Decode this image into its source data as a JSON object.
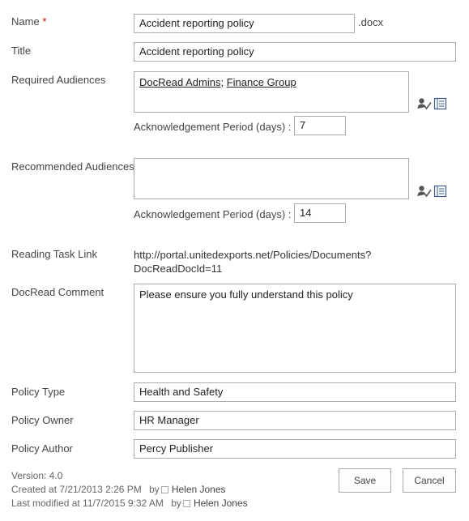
{
  "fields": {
    "name": {
      "label": "Name",
      "required_mark": "*",
      "value": "Accident reporting policy",
      "extension": ".docx"
    },
    "title": {
      "label": "Title",
      "value": "Accident reporting policy"
    },
    "required_audiences": {
      "label": "Required Audiences",
      "people": [
        "DocRead Admins",
        "Finance Group"
      ],
      "separator": ";",
      "ack_label": "Acknowledgement Period (days) :",
      "ack_value": "7"
    },
    "recommended_audiences": {
      "label": "Recommended Audiences",
      "ack_label": "Acknowledgement Period (days) :",
      "ack_value": "14"
    },
    "reading_task_link": {
      "label": "Reading Task Link",
      "line1": "http://portal.unitedexports.net/Policies/Documents?",
      "line2": "DocReadDocId=11"
    },
    "docread_comment": {
      "label": "DocRead Comment",
      "value": "Please ensure you fully understand this policy"
    },
    "policy_type": {
      "label": "Policy Type",
      "value": "Health and Safety"
    },
    "policy_owner": {
      "label": "Policy Owner",
      "value": "HR Manager"
    },
    "policy_author": {
      "label": "Policy Author",
      "value": "Percy Publisher"
    }
  },
  "footer": {
    "version": "Version: 4.0",
    "created": "Created at 7/21/2013 2:26 PM",
    "created_by_prefix": "by",
    "created_by": "Helen Jones",
    "modified": "Last modified at 11/7/2015 9:32 AM",
    "modified_by_prefix": "by",
    "modified_by": "Helen Jones"
  },
  "buttons": {
    "save": "Save",
    "cancel": "Cancel"
  },
  "icons": {
    "check_names": "check-names-icon",
    "browse": "address-book-icon"
  },
  "colors": {
    "border": "#ababab",
    "text": "#444444",
    "required": "#bf0000"
  }
}
